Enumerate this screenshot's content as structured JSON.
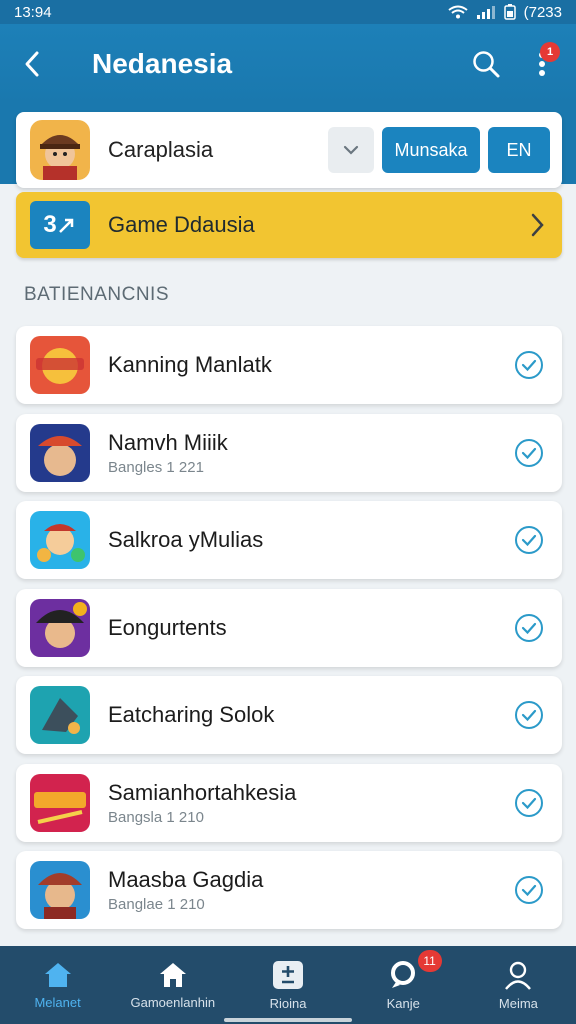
{
  "status_bar": {
    "time": "13:94",
    "battery": "(7233"
  },
  "app_bar": {
    "title": "Nedanesia",
    "notification_count": "1"
  },
  "profile": {
    "name": "Caraplasia",
    "action_label": "Munsaka",
    "language": "EN"
  },
  "promo": {
    "badge": "3",
    "label": "Game Ddausia"
  },
  "section": {
    "header": "BATIENANCNIS"
  },
  "games": [
    {
      "title": "Kanning Manlatk",
      "subtitle": "",
      "icon": "game-art-icon",
      "colors": [
        "#e6553a",
        "#f6c03c"
      ]
    },
    {
      "title": "Namvh Miiik",
      "subtitle": "Bangles 1 221",
      "icon": "game-art-icon",
      "colors": [
        "#243a8c",
        "#d74a2d"
      ]
    },
    {
      "title": "Salkroa yMulias",
      "subtitle": "",
      "icon": "game-art-icon",
      "colors": [
        "#29b2e8",
        "#f2b542"
      ]
    },
    {
      "title": "Eongurtents",
      "subtitle": "",
      "icon": "game-art-icon",
      "colors": [
        "#6d2fa0",
        "#f3b11d"
      ]
    },
    {
      "title": "Eatcharing Solok",
      "subtitle": "",
      "icon": "game-art-icon",
      "colors": [
        "#1ea3b0",
        "#3c4f5c"
      ]
    },
    {
      "title": "Samianhortahkesia",
      "subtitle": "Bangsla 1 210",
      "icon": "game-art-icon",
      "colors": [
        "#d2234e",
        "#f3a82b"
      ]
    },
    {
      "title": "Maasba Gagdia",
      "subtitle": "Banglae 1 210",
      "icon": "game-art-icon",
      "colors": [
        "#2a8fd0",
        "#a23d2a"
      ]
    }
  ],
  "bottom_nav": [
    {
      "label": "Melanet",
      "icon": "home-icon",
      "active": true
    },
    {
      "label": "Gamoenlanhin",
      "icon": "house-icon",
      "active": false
    },
    {
      "label": "Rioina",
      "icon": "plus-minus-icon",
      "active": false
    },
    {
      "label": "Kanje",
      "icon": "pin-icon",
      "active": false,
      "badge": "11"
    },
    {
      "label": "Meima",
      "icon": "user-icon",
      "active": false
    }
  ],
  "colors": {
    "primary": "#1a78ae",
    "accent": "#1b84bf",
    "promo": "#f2c531",
    "nav": "#234c6b",
    "active": "#4fb3f0"
  }
}
